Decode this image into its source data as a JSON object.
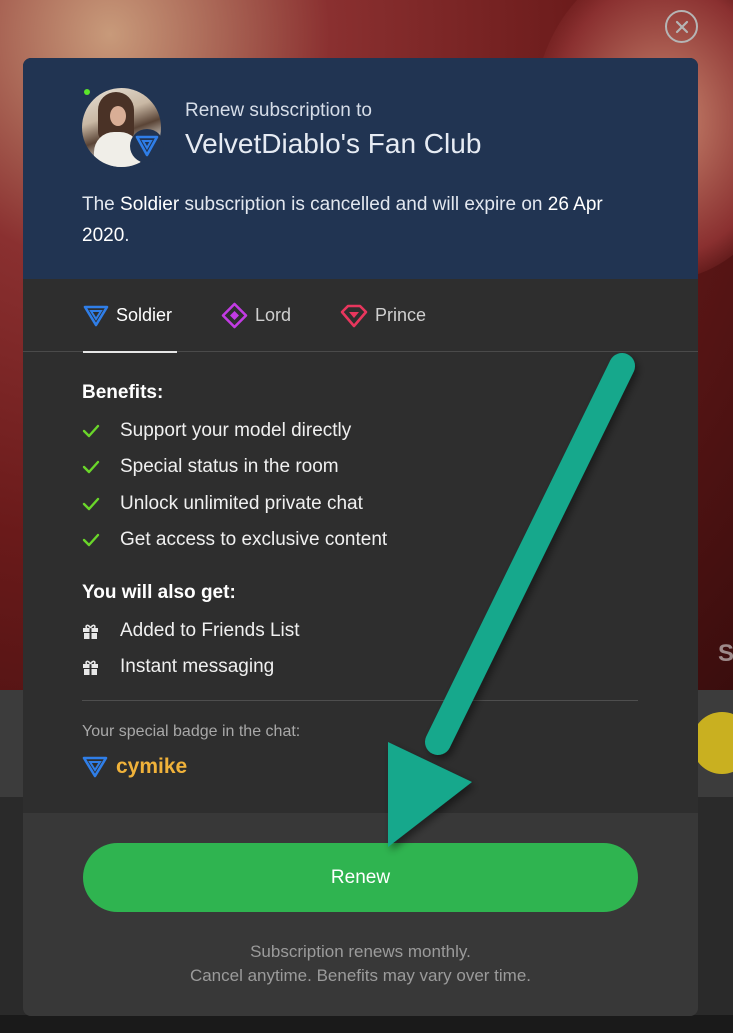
{
  "modal": {
    "subtitle": "Renew subscription to",
    "title": "VelvetDiablo's Fan Club",
    "status": {
      "prefix": "The ",
      "tier": "Soldier",
      "middle": " subscription is cancelled and will expire on ",
      "date": "26 Apr 2020",
      "suffix": "."
    }
  },
  "tabs": [
    {
      "label": "Soldier",
      "icon": "soldier-triangle-icon",
      "color": "#2f7ee8",
      "active": true
    },
    {
      "label": "Lord",
      "icon": "lord-diamond-icon",
      "color": "#c23be3",
      "active": false
    },
    {
      "label": "Prince",
      "icon": "prince-gem-icon",
      "color": "#e8365d",
      "active": false
    }
  ],
  "benefits": {
    "title": "Benefits:",
    "items": [
      "Support your model directly",
      "Special status in the room",
      "Unlock unlimited private chat",
      "Get access to exclusive content"
    ]
  },
  "extras": {
    "title": "You will also get:",
    "items": [
      "Added to Friends List",
      "Instant messaging"
    ]
  },
  "badge": {
    "label": "Your special badge in the chat:",
    "username": "cymike"
  },
  "footer": {
    "button_label": "Renew",
    "note_line1": "Subscription renews monthly.",
    "note_line2": "Cancel anytime. Benefits may vary over time."
  },
  "colors": {
    "header_bg": "#213452",
    "body_bg": "#2e2e2e",
    "footer_bg": "#383838",
    "renew_green": "#2fb450",
    "check_green": "#6ad62a",
    "username_gold": "#f0b23a",
    "annotation_arrow": "#12a88c"
  },
  "background_hint": {
    "partial_text": "S"
  }
}
